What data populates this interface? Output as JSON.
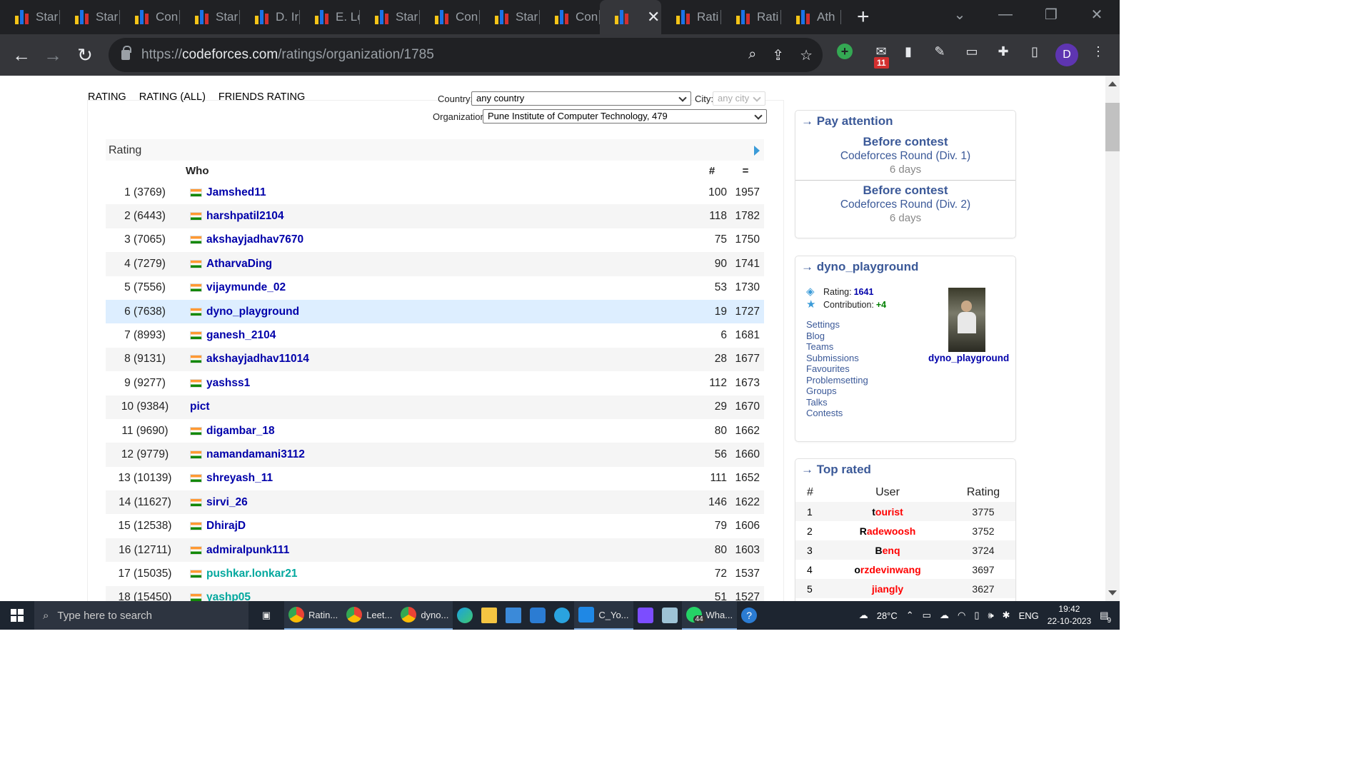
{
  "browser": {
    "tabs": [
      {
        "title": "Star"
      },
      {
        "title": "Star"
      },
      {
        "title": "Con"
      },
      {
        "title": "Star"
      },
      {
        "title": "D. Ir"
      },
      {
        "title": "E. Lo"
      },
      {
        "title": "Star"
      },
      {
        "title": "Con"
      },
      {
        "title": "Star"
      },
      {
        "title": "Con"
      },
      {
        "title": ""
      },
      {
        "title": "Rati"
      },
      {
        "title": "Rati"
      },
      {
        "title": "Ath"
      }
    ],
    "url_prefix": "https://",
    "url_domain": "codeforces.com",
    "url_path": "/ratings/organization/1785",
    "extension_badge": "11",
    "profile_initial": "D"
  },
  "filters": {
    "tabs": [
      "RATING",
      "RATING (ALL)",
      "FRIENDS RATING"
    ],
    "country_label": "Country:",
    "country_value": "any country",
    "city_label": "City:",
    "city_value": "any city",
    "org_label": "Organization:",
    "org_value": "Pune Institute of Computer Technology, 479"
  },
  "rating_table": {
    "title": "Rating",
    "columns": {
      "who": "Who",
      "contests": "#",
      "rating": "="
    },
    "rows": [
      {
        "rank": "1 (3769)",
        "handle": "Jamshed11",
        "flag": true,
        "contests": "100",
        "rating": "1957"
      },
      {
        "rank": "2 (6443)",
        "handle": "harshpatil2104",
        "flag": true,
        "contests": "118",
        "rating": "1782"
      },
      {
        "rank": "3 (7065)",
        "handle": "akshayjadhav7670",
        "flag": true,
        "contests": "75",
        "rating": "1750"
      },
      {
        "rank": "4 (7279)",
        "handle": "AtharvaDing",
        "flag": true,
        "contests": "90",
        "rating": "1741"
      },
      {
        "rank": "5 (7556)",
        "handle": "vijaymunde_02",
        "flag": true,
        "contests": "53",
        "rating": "1730"
      },
      {
        "rank": "6 (7638)",
        "handle": "dyno_playground",
        "flag": true,
        "contests": "19",
        "rating": "1727",
        "highlight": true
      },
      {
        "rank": "7 (8993)",
        "handle": "ganesh_2104",
        "flag": true,
        "contests": "6",
        "rating": "1681"
      },
      {
        "rank": "8 (9131)",
        "handle": "akshayjadhav11014",
        "flag": true,
        "contests": "28",
        "rating": "1677"
      },
      {
        "rank": "9 (9277)",
        "handle": "yashss1",
        "flag": true,
        "contests": "112",
        "rating": "1673"
      },
      {
        "rank": "10 (9384)",
        "handle": "pict",
        "flag": false,
        "contests": "29",
        "rating": "1670"
      },
      {
        "rank": "11 (9690)",
        "handle": "digambar_18",
        "flag": true,
        "contests": "80",
        "rating": "1662"
      },
      {
        "rank": "12 (9779)",
        "handle": "namandamani3112",
        "flag": true,
        "contests": "56",
        "rating": "1660"
      },
      {
        "rank": "13 (10139)",
        "handle": "shreyash_11",
        "flag": true,
        "contests": "111",
        "rating": "1652"
      },
      {
        "rank": "14 (11627)",
        "handle": "sirvi_26",
        "flag": true,
        "contests": "146",
        "rating": "1622"
      },
      {
        "rank": "15 (12538)",
        "handle": "DhirajD",
        "flag": true,
        "contests": "79",
        "rating": "1606"
      },
      {
        "rank": "16 (12711)",
        "handle": "admiralpunk111",
        "flag": true,
        "contests": "80",
        "rating": "1603"
      },
      {
        "rank": "17 (15035)",
        "handle": "pushkar.lonkar21",
        "flag": true,
        "contests": "72",
        "rating": "1537",
        "cyan": true
      },
      {
        "rank": "18 (15450)",
        "handle": "yashp05",
        "flag": true,
        "contests": "51",
        "rating": "1527",
        "cyan": true
      }
    ]
  },
  "pay_attention": {
    "title": "→ Pay attention",
    "contests": [
      {
        "head": "Before contest",
        "name": "Codeforces Round (Div. 1)",
        "days": "6 days"
      },
      {
        "head": "Before contest",
        "name": "Codeforces Round (Div. 2)",
        "days": "6 days"
      }
    ]
  },
  "profile": {
    "title": "→ dyno_playground",
    "rating_label": "Rating:",
    "rating_value": "1641",
    "contribution_label": "Contribution:",
    "contribution_value": "+4",
    "links": [
      "Settings",
      "Blog",
      "Teams",
      "Submissions",
      "Favourites",
      "Problemsetting",
      "Groups",
      "Talks",
      "Contests"
    ],
    "handle": "dyno_playground"
  },
  "top_rated": {
    "title": "→ Top rated",
    "columns": [
      "#",
      "User",
      "Rating"
    ],
    "rows": [
      {
        "n": "1",
        "first": "t",
        "rest": "ourist",
        "rating": "3775"
      },
      {
        "n": "2",
        "first": "R",
        "rest": "adewoosh",
        "rating": "3752"
      },
      {
        "n": "3",
        "first": "B",
        "rest": "enq",
        "rating": "3724"
      },
      {
        "n": "4",
        "first": "o",
        "rest": "rzdevinwang",
        "rating": "3697"
      },
      {
        "n": "5",
        "first": "",
        "rest": "jiangly",
        "rating": "3627"
      }
    ]
  },
  "taskbar": {
    "search_placeholder": "Type here to search",
    "apps": [
      "Ratin...",
      "Leet...",
      "dyno...",
      "C_Yo...",
      "Wha..."
    ],
    "whatsapp_badge": "44",
    "weather": "28°C",
    "lang": "ENG",
    "time": "19:42",
    "date": "22-10-2023",
    "notif_count": "9"
  }
}
